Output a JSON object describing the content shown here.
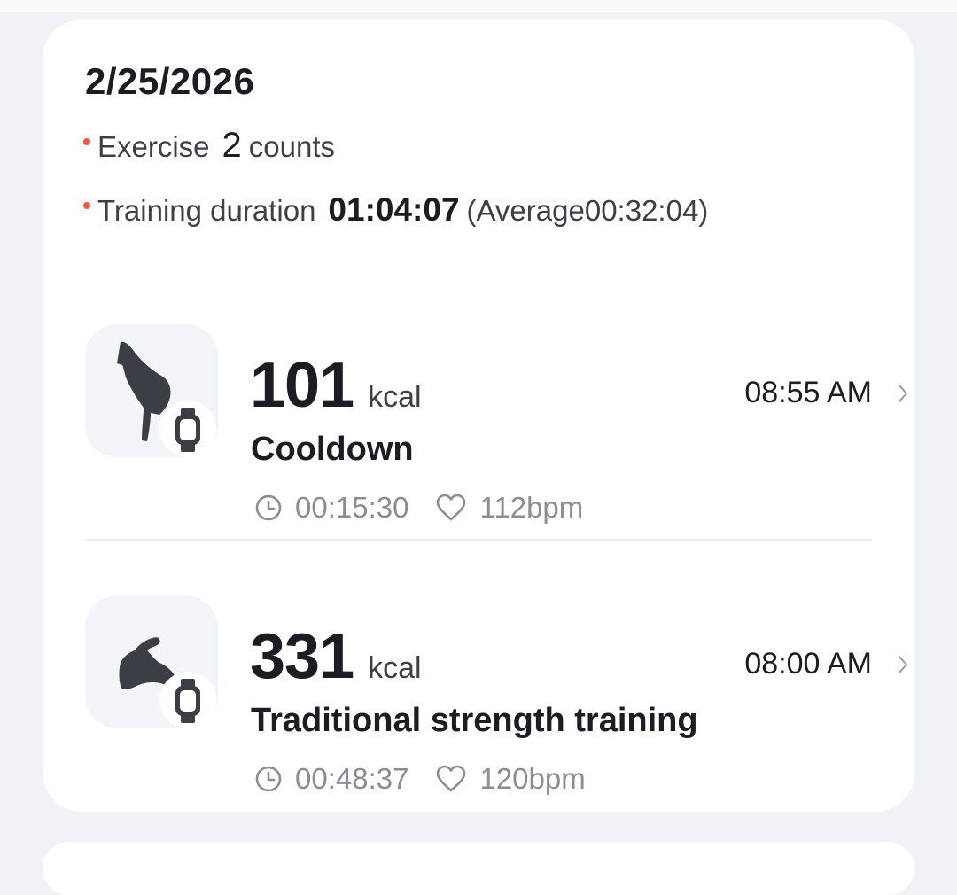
{
  "summary": {
    "date": "2/25/2026",
    "exercise_label": "Exercise",
    "exercise_count": "2",
    "exercise_unit": "counts",
    "duration_label": "Training duration",
    "duration_total": "01:04:07",
    "duration_average": "(Average00:32:04)"
  },
  "workouts": [
    {
      "kcal": "101",
      "kcal_unit": "kcal",
      "time": "08:55 AM",
      "name": "Cooldown",
      "duration": "00:15:30",
      "heart_rate": "112bpm",
      "icon": "stretching-figure-icon"
    },
    {
      "kcal": "331",
      "kcal_unit": "kcal",
      "time": "08:00 AM",
      "name": "Traditional strength training",
      "duration": "00:48:37",
      "heart_rate": "120bpm",
      "icon": "flexed-arm-icon"
    }
  ],
  "colors": {
    "accent_dot": "#ef5a3a",
    "background": "#f1f2f6",
    "card": "#ffffff",
    "icon_tile": "#f3f4f8",
    "icon_dark": "#3b3e45",
    "secondary_text": "#8a8d94"
  }
}
